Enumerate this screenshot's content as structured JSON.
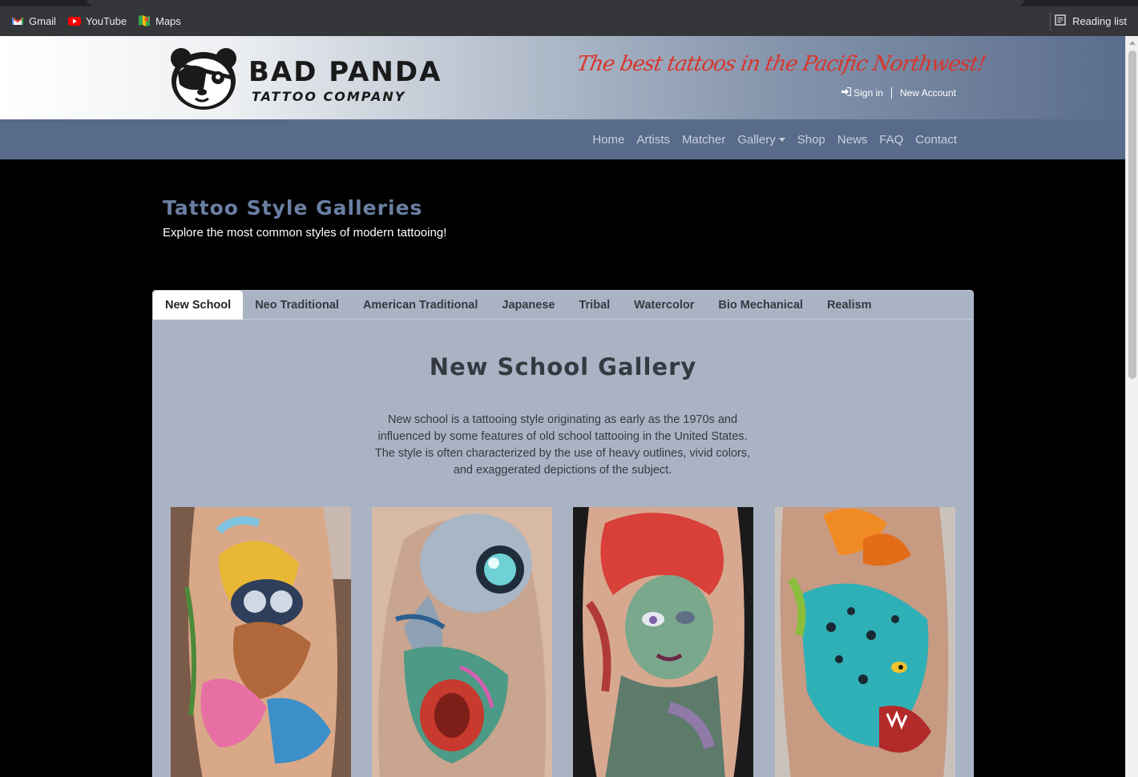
{
  "browser": {
    "bookmarks": [
      {
        "label": "Gmail",
        "icon": "gmail-icon"
      },
      {
        "label": "YouTube",
        "icon": "youtube-icon"
      },
      {
        "label": "Maps",
        "icon": "maps-icon"
      }
    ],
    "reading_list": "Reading list"
  },
  "header": {
    "logo_title": "BAD PANDA",
    "logo_subtitle": "TATTOO COMPANY",
    "tagline": "The best tattoos in the Pacific Northwest!",
    "sign_in": "Sign in",
    "new_account": "New Account"
  },
  "nav": {
    "items": [
      "Home",
      "Artists",
      "Matcher",
      "Gallery",
      "Shop",
      "News",
      "FAQ",
      "Contact"
    ]
  },
  "page": {
    "title": "Tattoo Style Galleries",
    "subtitle": "Explore the most common styles of modern tattooing!"
  },
  "tabs": {
    "items": [
      "New School",
      "Neo Traditional",
      "American Traditional",
      "Japanese",
      "Tribal",
      "Watercolor",
      "Bio Mechanical",
      "Realism"
    ],
    "active": "New School"
  },
  "gallery": {
    "title": "New School Gallery",
    "description": "New school is a tattooing style originating as early as the 1970s and influenced by some features of old school tattooing in the United States. The style is often characterized by the use of heavy outlines, vivid colors, and exaggerated depictions of the subject.",
    "images": [
      {
        "name": "gallery-image-beaver"
      },
      {
        "name": "gallery-image-alien-skull"
      },
      {
        "name": "gallery-image-zombie-girl"
      },
      {
        "name": "gallery-image-leopard"
      }
    ]
  },
  "colors": {
    "nav_bg": "#586b8b",
    "tagline": "#d9342b",
    "title": "#6a7fa3",
    "card_bg": "#a9b3c4"
  }
}
